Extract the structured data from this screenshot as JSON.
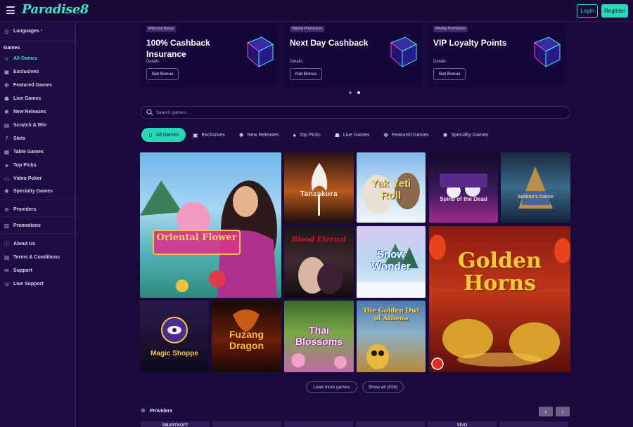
{
  "header": {
    "logo_text": "Paradise8",
    "login_label": "Login",
    "register_label": "Register"
  },
  "sidebar": {
    "languages_label": "Languages",
    "games_heading": "Games",
    "items": [
      {
        "label": "All Games",
        "icon": "horseshoe-icon",
        "active": true
      },
      {
        "label": "Exclusives",
        "icon": "vault-icon"
      },
      {
        "label": "Featured Games",
        "icon": "clover-icon"
      },
      {
        "label": "Live Games",
        "icon": "dealer-icon"
      },
      {
        "label": "New Releases",
        "icon": "new-icon"
      },
      {
        "label": "Scratch & Win",
        "icon": "scratch-icon"
      },
      {
        "label": "Slots",
        "icon": "seven-icon"
      },
      {
        "label": "Table Games",
        "icon": "table-icon"
      },
      {
        "label": "Top Picks",
        "icon": "top-icon"
      },
      {
        "label": "Video Poker",
        "icon": "poker-icon"
      },
      {
        "label": "Specialty Games",
        "icon": "specialty-icon"
      }
    ],
    "providers_label": "Providers",
    "promotions_label": "Promotions",
    "bottom_items": [
      {
        "label": "About Us",
        "icon": "info-icon"
      },
      {
        "label": "Terms & Conditions",
        "icon": "document-icon"
      },
      {
        "label": "Support",
        "icon": "chat-icon"
      },
      {
        "label": "Live Support",
        "icon": "headset-icon"
      }
    ]
  },
  "promos": [
    {
      "tag": "Welcome Bonus",
      "title": "100% Cashback Insurance",
      "details": "Details",
      "button": "Get Bonus"
    },
    {
      "tag": "Weekly Promotions",
      "title": "Next Day Cashback",
      "details": "Details",
      "button": "Get Bonus"
    },
    {
      "tag": "Weekly Promotions",
      "title": "VIP Loyalty Points",
      "details": "Details",
      "button": "Get Bonus"
    }
  ],
  "search": {
    "placeholder": "Search games . . ."
  },
  "tabs": [
    {
      "label": "All Games",
      "icon": "horseshoe-icon",
      "active": true
    },
    {
      "label": "Exclusives",
      "icon": "vault-icon"
    },
    {
      "label": "New Releases",
      "icon": "new-icon"
    },
    {
      "label": "Top Picks",
      "icon": "top-icon"
    },
    {
      "label": "Live Games",
      "icon": "dealer-icon"
    },
    {
      "label": "Featured Games",
      "icon": "clover-icon"
    },
    {
      "label": "Specialty Games",
      "icon": "specialty-icon"
    }
  ],
  "games": [
    {
      "title": "Oriental Flower"
    },
    {
      "title": "Tanzakura"
    },
    {
      "title": "Yak Yeti Roll"
    },
    {
      "title": "Spins of the Dead"
    },
    {
      "title": "Sphinx's Curse"
    },
    {
      "title": "Blood Eternal"
    },
    {
      "title": "Snow Wonder"
    },
    {
      "title": "Golden Horns"
    },
    {
      "title": "Magic Shoppe"
    },
    {
      "title": "Fuzang Dragon"
    },
    {
      "title": "Thai Blossoms"
    },
    {
      "title": "The Golden Owl of Athena"
    }
  ],
  "buttons": {
    "load_more": "Load more games",
    "show_all": "Show all (824)"
  },
  "providers": {
    "title": "Providers",
    "prev": "‹",
    "next": "›",
    "logos": [
      "SMARTSOFT",
      "",
      "",
      "",
      "VIVO",
      ""
    ]
  },
  "colors": {
    "background": "#1b0b3d",
    "accent": "#28d8b6",
    "sidebar": "#1d0c42"
  }
}
